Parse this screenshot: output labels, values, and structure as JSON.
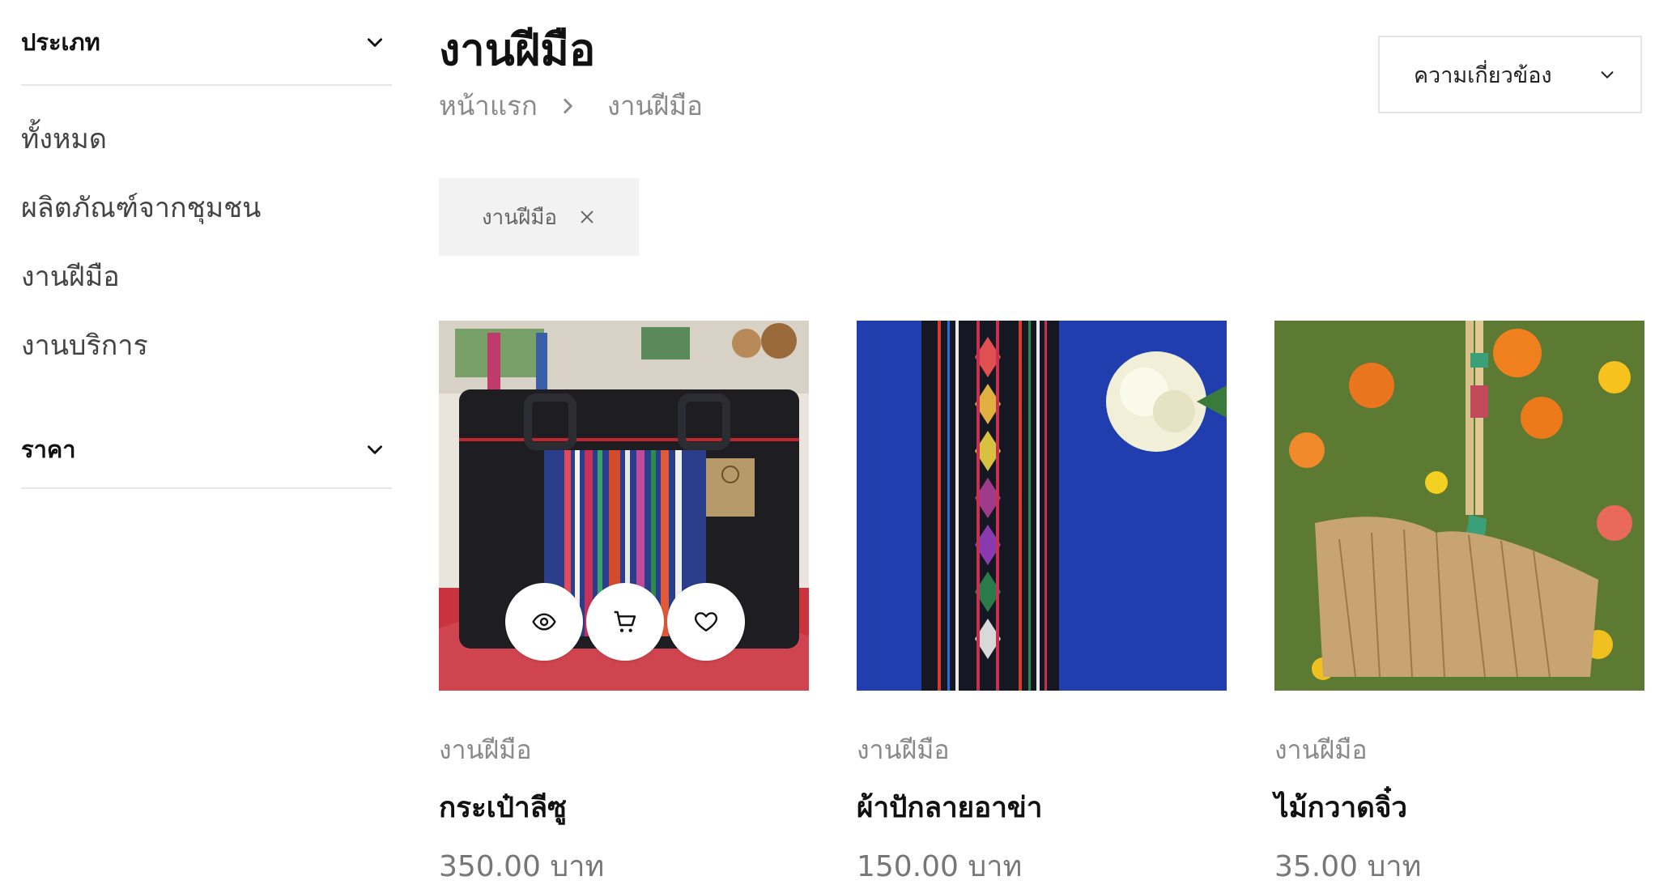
{
  "sidebar": {
    "category_heading": "ประเภท",
    "categories": [
      "ทั้งหมด",
      "ผลิตภัณฑ์จากชุมชน",
      "งานฝีมือ",
      "งานบริการ"
    ],
    "price_heading": "ราคา"
  },
  "header": {
    "title": "งานฝีมือ",
    "breadcrumb": {
      "home": "หน้าแรก",
      "current": "งานฝีมือ"
    },
    "sort_label": "ความเกี่ยวข้อง"
  },
  "active_filter": {
    "label": "งานฝีมือ"
  },
  "products": [
    {
      "category": "งานฝีมือ",
      "name": "กระเป๋าลีซู",
      "price": "350.00 บาท"
    },
    {
      "category": "งานฝีมือ",
      "name": "ผ้าปักลายอาข่า",
      "price": "150.00 บาท"
    },
    {
      "category": "งานฝีมือ",
      "name": "ไม้กวาดจิ๋ว",
      "price": "35.00 บาท"
    }
  ],
  "icons": {
    "quick_view": "eye-icon",
    "add_to_cart": "cart-icon",
    "wishlist": "heart-icon",
    "remove_filter": "close-icon",
    "dropdown": "chevron-down-icon",
    "breadcrumb_separator": "chevron-right-icon"
  },
  "colors": {
    "text": "#111111",
    "muted": "#8a8a8a",
    "chip_bg": "#f2f2f2",
    "divider": "#e6e6e6"
  }
}
